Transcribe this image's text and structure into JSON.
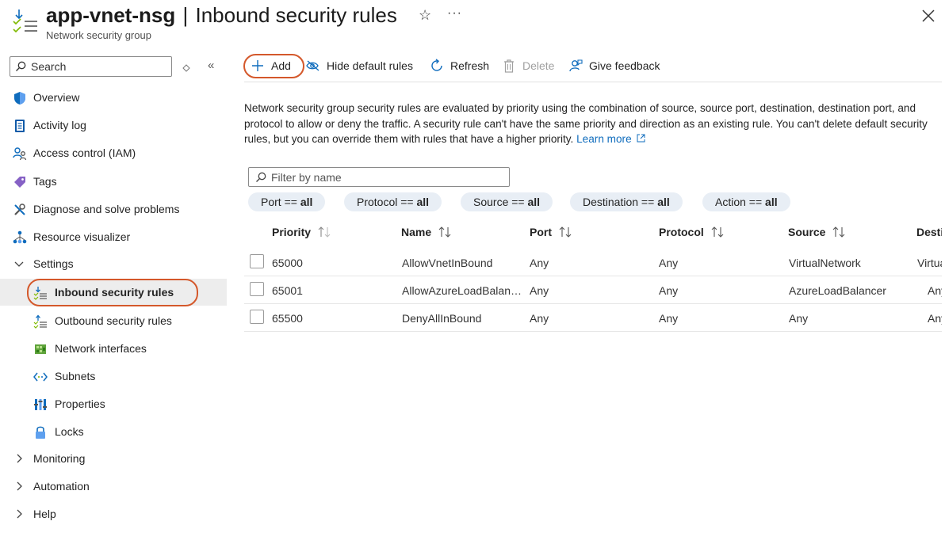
{
  "header": {
    "resource_name": "app-vnet-nsg",
    "separator": "|",
    "page_title": "Inbound security rules",
    "subtitle": "Network security group",
    "star_glyph": "☆",
    "more_glyph": "···"
  },
  "sidebar": {
    "search_placeholder": "Search",
    "collapse_glyph": "«",
    "items": [
      {
        "label": "Overview",
        "icon": "shield-icon"
      },
      {
        "label": "Activity log",
        "icon": "activity-log-icon"
      },
      {
        "label": "Access control (IAM)",
        "icon": "people-icon"
      },
      {
        "label": "Tags",
        "icon": "tag-icon"
      },
      {
        "label": "Diagnose and solve problems",
        "icon": "wrench-icon"
      },
      {
        "label": "Resource visualizer",
        "icon": "hierarchy-icon"
      },
      {
        "label": "Settings",
        "icon": "chevron-down-icon"
      },
      {
        "label": "Inbound security rules",
        "icon": "inbound-rules-icon",
        "active": true
      },
      {
        "label": "Outbound security rules",
        "icon": "outbound-rules-icon"
      },
      {
        "label": "Network interfaces",
        "icon": "network-interface-icon"
      },
      {
        "label": "Subnets",
        "icon": "subnet-icon"
      },
      {
        "label": "Properties",
        "icon": "properties-icon"
      },
      {
        "label": "Locks",
        "icon": "lock-icon"
      },
      {
        "label": "Monitoring",
        "icon": "chevron-right-icon"
      },
      {
        "label": "Automation",
        "icon": "chevron-right-icon"
      },
      {
        "label": "Help",
        "icon": "chevron-right-icon"
      }
    ]
  },
  "toolbar": {
    "add_label": "Add",
    "hide_default_label": "Hide default rules",
    "refresh_label": "Refresh",
    "delete_label": "Delete",
    "feedback_label": "Give feedback"
  },
  "description": {
    "text": "Network security group security rules are evaluated by priority using the combination of source, source port, destination, destination port, and protocol to allow or deny the traffic. A security rule can't have the same priority and direction as an existing rule. You can't delete default security rules, but you can override them with rules that have a higher priority.",
    "learn_more": "Learn more"
  },
  "filter": {
    "placeholder": "Filter by name",
    "pills": [
      {
        "key": "Port ==",
        "value": "all"
      },
      {
        "key": "Protocol ==",
        "value": "all"
      },
      {
        "key": "Source ==",
        "value": "all"
      },
      {
        "key": "Destination ==",
        "value": "all"
      },
      {
        "key": "Action ==",
        "value": "all"
      }
    ]
  },
  "table": {
    "columns": [
      "Priority",
      "Name",
      "Port",
      "Protocol",
      "Source",
      "Destination"
    ],
    "rows": [
      {
        "priority": "65000",
        "name": "AllowVnetInBound",
        "port": "Any",
        "protocol": "Any",
        "source": "VirtualNetwork",
        "destination": "VirtualNetwork"
      },
      {
        "priority": "65001",
        "name": "AllowAzureLoadBalan…",
        "port": "Any",
        "protocol": "Any",
        "source": "AzureLoadBalancer",
        "destination": "Any"
      },
      {
        "priority": "65500",
        "name": "DenyAllInBound",
        "port": "Any",
        "protocol": "Any",
        "source": "Any",
        "destination": "Any"
      }
    ]
  },
  "colors": {
    "accent": "#0f6cbd",
    "highlight_ring": "#d4582b",
    "pill_bg": "#e8eef5",
    "active_bg": "#ededed"
  }
}
